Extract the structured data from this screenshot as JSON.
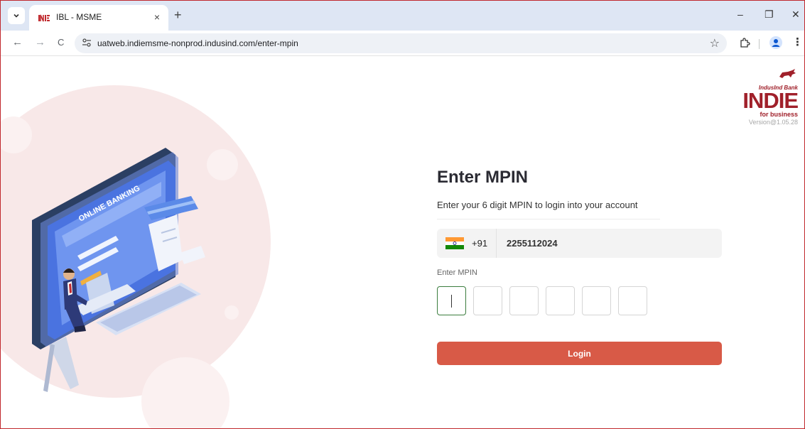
{
  "browser": {
    "tab_title": "IBL - MSME",
    "tab_close": "×",
    "new_tab": "+",
    "url": "uatweb.indiemsme-nonprod.indusind.com/enter-mpin",
    "controls": {
      "minimize": "–",
      "restore": "❐",
      "close": "✕"
    },
    "nav": {
      "back": "←",
      "forward": "→",
      "reload": "C"
    },
    "star": "☆",
    "menu": "⋮"
  },
  "brand": {
    "bank": "IndusInd Bank",
    "product": "INDIE",
    "tagline": "for business",
    "version": "Version@1.05.28"
  },
  "illustration": {
    "screen_text": "ONLINE BANKING"
  },
  "form": {
    "title": "Enter MPIN",
    "subtitle": "Enter your 6 digit MPIN to login into your account",
    "country_code": "+91",
    "phone": "2255112024",
    "mpin_label": "Enter MPIN",
    "mpin_count": 6,
    "login_label": "Login"
  },
  "colors": {
    "accent": "#d85a47",
    "brand": "#a0202a",
    "active_border": "#3b7d3e"
  }
}
